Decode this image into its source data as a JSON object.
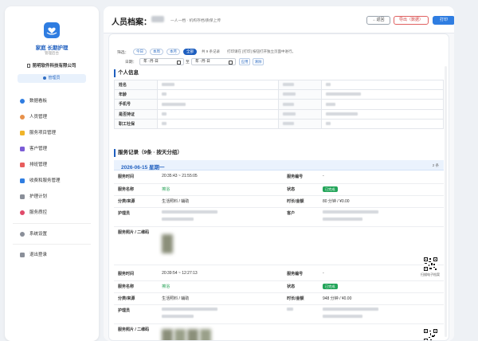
{
  "sidebar": {
    "brand_name": "家庭 长期护理",
    "brand_sub": "管理后台",
    "company": "昆明软件科技有限公司",
    "role": "管理员",
    "items": [
      {
        "label": "数据看板",
        "icon": "pie-chart-icon",
        "color": "#2f7de1"
      },
      {
        "label": "人员管理",
        "icon": "users-icon",
        "color": "#e8914a"
      },
      {
        "label": "服务项目管理",
        "icon": "tag-icon",
        "color": "#f0b429"
      },
      {
        "label": "客户管理",
        "icon": "customer-icon",
        "color": "#7b5cd6"
      },
      {
        "label": "排班管理",
        "icon": "schedule-icon",
        "color": "#e85d5d"
      },
      {
        "label": "收费和服务管理",
        "icon": "finance-icon",
        "color": "#2f7de1"
      },
      {
        "label": "护理计划",
        "icon": "plan-icon",
        "color": "#8a8f99"
      },
      {
        "label": "服务质控",
        "icon": "heart-icon",
        "color": "#e04a6a"
      },
      {
        "label": "系统设置",
        "icon": "gear-icon",
        "color": "#8a8f99"
      },
      {
        "label": "退出登录",
        "icon": "logout-icon",
        "color": "#8a8f99"
      }
    ]
  },
  "header": {
    "title": "人员档案：",
    "subtitle": "一人一档 · 机构存档/质保上传",
    "back": "←返回",
    "export": "导出（数据）",
    "print": "打印"
  },
  "filter": {
    "range_label": "筛选：",
    "chips": [
      {
        "label": "今日",
        "active": false
      },
      {
        "label": "本周",
        "active": false
      },
      {
        "label": "本月",
        "active": false
      },
      {
        "label": "全部",
        "active": true
      }
    ],
    "count_note": "共 9 条记录",
    "print_note": "打印请在 [打印] 按钮打开独立页面中进行。",
    "date_label": "日期：",
    "date_from": "年 -月-日",
    "date_to": "年 -月-日",
    "to_label": "至",
    "apply": "应用",
    "clear": "清除"
  },
  "personal": {
    "title": "个人信息",
    "rows": [
      "姓名",
      "年龄",
      "手机号",
      "是否持证",
      "职工社保"
    ]
  },
  "records": {
    "title": "服务记录（9条 · 按天分组）",
    "day": "2026-06-15 星期一",
    "day_count": "2 条",
    "labels": {
      "time": "服务时间",
      "no": "服务编号",
      "name": "服务名称",
      "status": "状态",
      "category": "分类/来源",
      "duration": "时长/金额",
      "nurse": "护理员",
      "customer": "客户",
      "photos": "服务照片 / 二维码"
    },
    "items": [
      {
        "time": "20:35:43 ~ 21:55:05",
        "no": "-",
        "name": "擦浴",
        "status": "已完成",
        "category": "生活照料 / 辅助",
        "duration": "80 分钟 / ¥0.00"
      },
      {
        "time": "20:39:54 ~ 12:27:13",
        "no": "-",
        "name": "擦浴",
        "status": "已完成",
        "category": "生活照料 / 辅助",
        "duration": "948 分钟 / ¥0.00"
      }
    ],
    "qr_label": "扫描电子档案"
  }
}
